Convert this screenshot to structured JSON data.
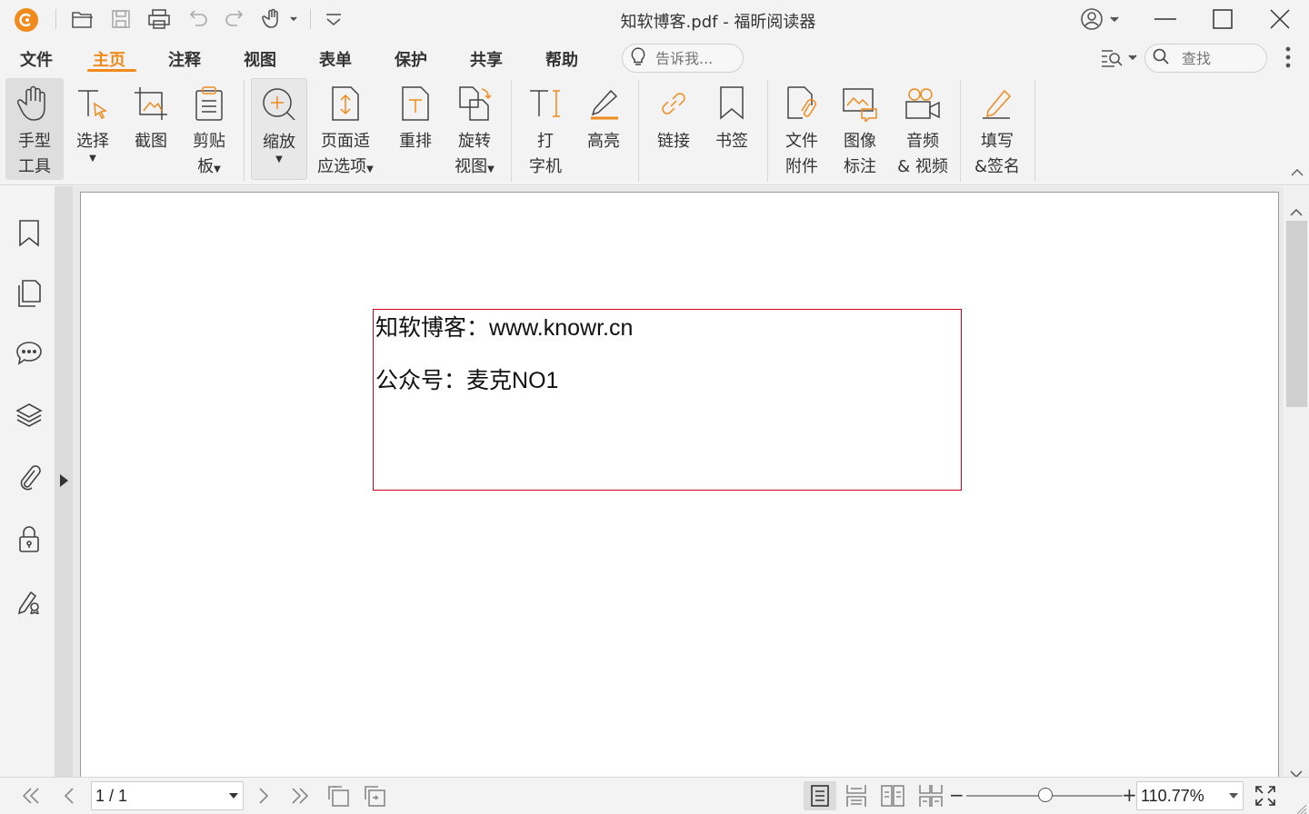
{
  "window": {
    "title": "知软博客.pdf - 福昕阅读器"
  },
  "menu": {
    "tabs": [
      "文件",
      "主页",
      "注释",
      "视图",
      "表单",
      "保护",
      "共享",
      "帮助"
    ],
    "active": "主页",
    "tell_me_placeholder": "告诉我...",
    "search_placeholder": "查找"
  },
  "ribbon": {
    "hand_tool": [
      "手型",
      "工具"
    ],
    "select": "选择",
    "snapshot": "截图",
    "clipboard": [
      "剪贴",
      "板"
    ],
    "zoom": "缩放",
    "fit_page": [
      "页面适",
      "应选项"
    ],
    "reflow": "重排",
    "rotate": [
      "旋转",
      "视图"
    ],
    "typewriter": [
      "打",
      "字机"
    ],
    "highlight": "高亮",
    "link": "链接",
    "bookmark": "书签",
    "file_attachment": [
      "文件",
      "附件"
    ],
    "image_annotation": [
      "图像",
      "标注"
    ],
    "audio_video": [
      "音频",
      "& 视频"
    ],
    "fill_sign": [
      "填写",
      "&签名"
    ]
  },
  "document": {
    "line1_cn": "知软博客：",
    "line1_latin": "www.knowr.cn",
    "line2_cn": "公众号：麦克",
    "line2_latin": "NO1"
  },
  "status": {
    "page_value": "1 / 1",
    "zoom_value": "110.77%"
  },
  "colors": {
    "accent": "#f08a1c",
    "textbox_border": "#d0021b"
  }
}
